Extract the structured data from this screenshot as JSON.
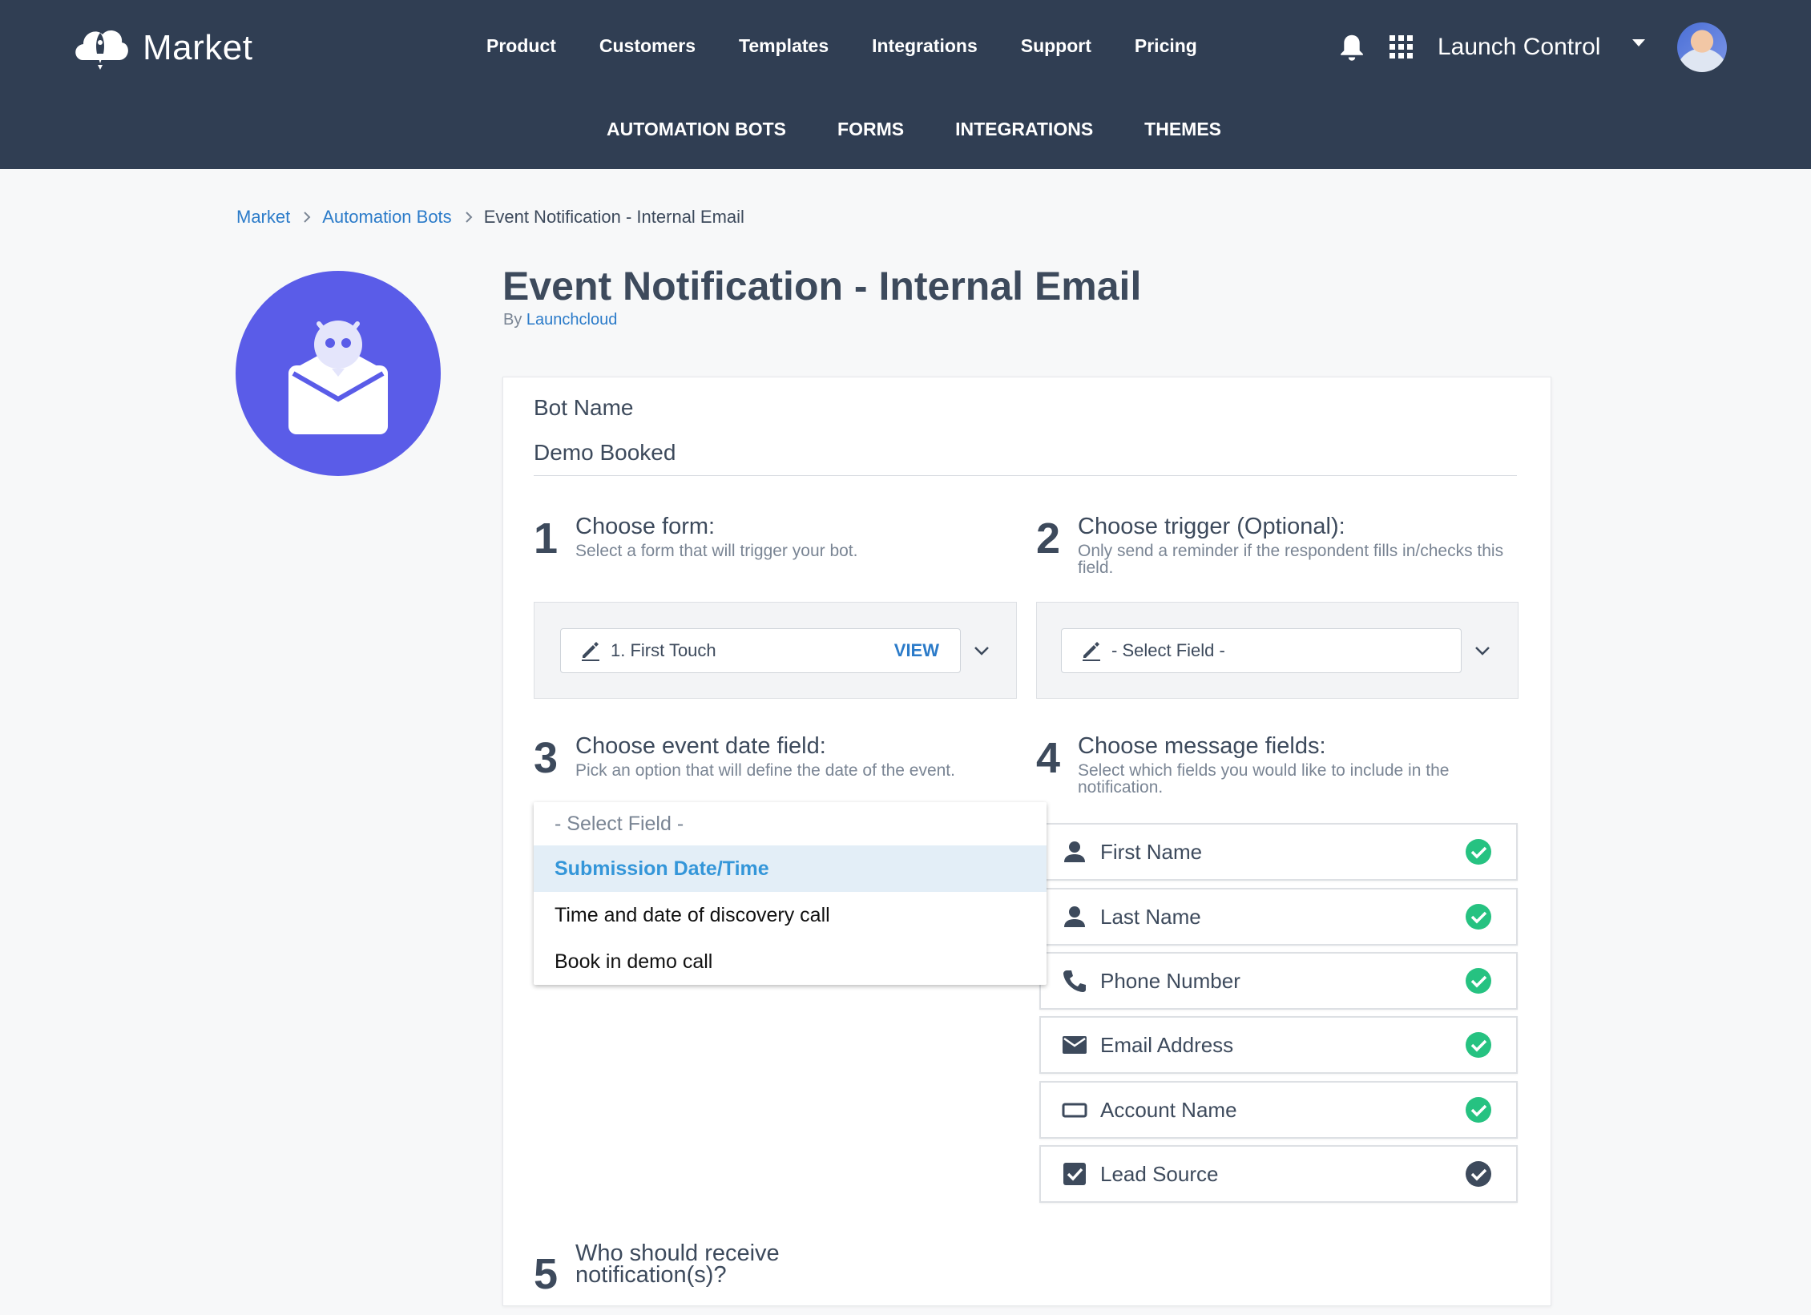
{
  "brand": {
    "name": "Market"
  },
  "nav": {
    "main": [
      "Product",
      "Customers",
      "Templates",
      "Integrations",
      "Support",
      "Pricing"
    ],
    "sub": [
      "AUTOMATION BOTS",
      "FORMS",
      "INTEGRATIONS",
      "THEMES"
    ]
  },
  "header": {
    "workspace": "Launch Control"
  },
  "breadcrumb": {
    "items": [
      "Market",
      "Automation Bots"
    ],
    "current": "Event Notification - Internal Email"
  },
  "page": {
    "title": "Event Notification - Internal Email",
    "by_prefix": "By",
    "author": "Launchcloud"
  },
  "bot": {
    "name_label": "Bot Name",
    "name_value": "Demo Booked"
  },
  "steps": [
    {
      "num": "1",
      "title": "Choose form:",
      "desc": "Select a form that will trigger your bot."
    },
    {
      "num": "2",
      "title": "Choose trigger (Optional):",
      "desc": "Only send a reminder if the respondent fills in/checks this field."
    },
    {
      "num": "3",
      "title": "Choose event date field:",
      "desc": "Pick an option that will define the date of the event."
    },
    {
      "num": "4",
      "title": "Choose message fields:",
      "desc": "Select which fields you would like to include in the notification."
    },
    {
      "num": "5",
      "title": "Who should receive notification(s)?",
      "desc": ""
    }
  ],
  "form_select": {
    "value": "1. First Touch",
    "action": "VIEW"
  },
  "trigger_select": {
    "value": "- Select Field -"
  },
  "date_dropdown": {
    "placeholder": "- Select Field -",
    "options": [
      "Submission Date/Time",
      "Time and date of discovery call",
      "Book in demo call"
    ],
    "highlighted_index": 0
  },
  "message_fields": [
    {
      "label": "First Name",
      "icon": "person-icon",
      "checked_color": "#26c281"
    },
    {
      "label": "Last Name",
      "icon": "person-icon",
      "checked_color": "#26c281"
    },
    {
      "label": "Phone Number",
      "icon": "phone-icon",
      "checked_color": "#26c281"
    },
    {
      "label": "Email Address",
      "icon": "mail-icon",
      "checked_color": "#26c281"
    },
    {
      "label": "Account Name",
      "icon": "input-box-icon",
      "checked_color": "#26c281"
    },
    {
      "label": "Lead Source",
      "icon": "checkbox-icon",
      "checked_color": "#3d4a5c"
    }
  ],
  "colors": {
    "header_bg": "#303e53",
    "accent": "#5a5ce8",
    "link": "#2b7bc9",
    "check_green": "#26c281"
  }
}
